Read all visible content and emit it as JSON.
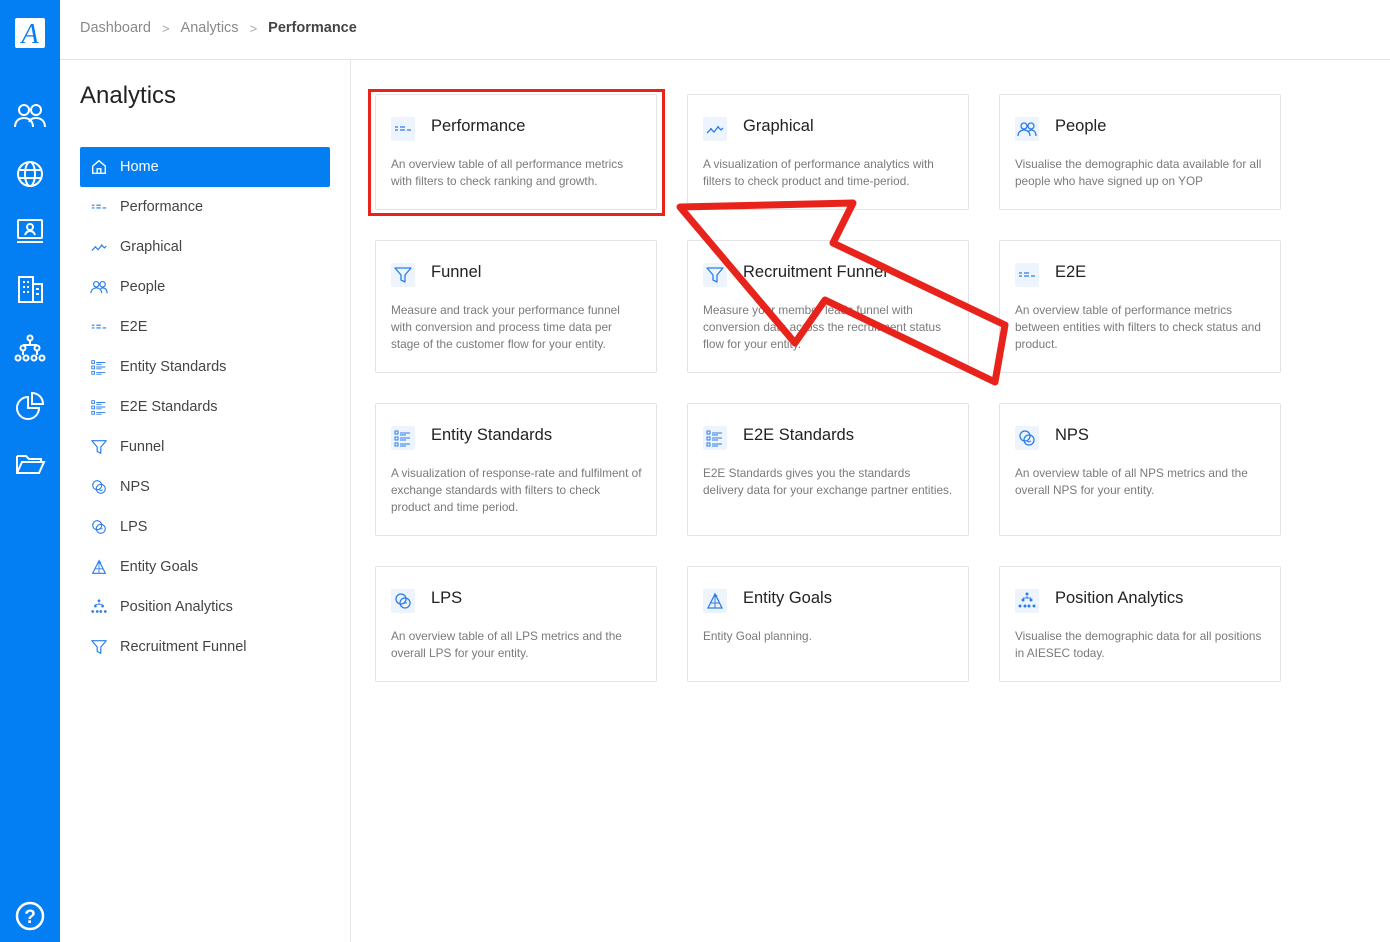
{
  "app": {
    "logo_letter": "A",
    "accent": "#037ef3",
    "highlight_color": "#e8231c"
  },
  "rail": {
    "icons": [
      "people-icon",
      "globe-icon",
      "presentation-icon",
      "building-icon",
      "org-chart-icon",
      "pie-chart-icon",
      "folder-icon",
      "help-icon"
    ],
    "help_label": "?"
  },
  "breadcrumb": {
    "items": [
      "Dashboard",
      "Analytics",
      "Performance"
    ],
    "separator": ">"
  },
  "sidenav": {
    "title": "Analytics",
    "items": [
      {
        "label": "Home",
        "icon": "home-icon",
        "active": true
      },
      {
        "label": "Performance",
        "icon": "table-lines-icon"
      },
      {
        "label": "Graphical",
        "icon": "line-graph-icon"
      },
      {
        "label": "People",
        "icon": "people-icon"
      },
      {
        "label": "E2E",
        "icon": "table-lines-icon"
      },
      {
        "label": "Entity Standards",
        "icon": "checklist-icon"
      },
      {
        "label": "E2E Standards",
        "icon": "checklist-icon"
      },
      {
        "label": "Funnel",
        "icon": "funnel-icon"
      },
      {
        "label": "NPS",
        "icon": "nps-icon"
      },
      {
        "label": "LPS",
        "icon": "lps-icon"
      },
      {
        "label": "Entity Goals",
        "icon": "goal-icon"
      },
      {
        "label": "Position Analytics",
        "icon": "org-chart-icon"
      },
      {
        "label": "Recruitment Funnel",
        "icon": "funnel-icon"
      }
    ]
  },
  "cards": [
    {
      "title": "Performance",
      "icon": "table-lines-icon",
      "desc": "An overview table of all performance metrics with filters to check ranking and growth."
    },
    {
      "title": "Graphical",
      "icon": "line-graph-icon",
      "desc": "A visualization of performance analytics with filters to check product and time-period."
    },
    {
      "title": "People",
      "icon": "people-icon",
      "desc": "Visualise the demographic data available for all people who have signed up on YOP"
    },
    {
      "title": "Funnel",
      "icon": "funnel-icon",
      "desc": "Measure and track your performance funnel with conversion and process time data per stage of the customer flow for your entity."
    },
    {
      "title": "Recruitment Funnel",
      "icon": "funnel-icon",
      "desc": "Measure your member leads funnel with conversion data across the recruitment status flow for your entity."
    },
    {
      "title": "E2E",
      "icon": "table-lines-icon",
      "desc": "An overview table of performance metrics between entities with filters to check status and product."
    },
    {
      "title": "Entity Standards",
      "icon": "checklist-icon",
      "desc": "A visualization of response-rate and fulfilment of exchange standards with filters to check product and time period."
    },
    {
      "title": "E2E Standards",
      "icon": "checklist-icon",
      "desc": "E2E Standards gives you the standards delivery data for your exchange partner entities."
    },
    {
      "title": "NPS",
      "icon": "nps-icon",
      "desc": "An overview table of all NPS metrics and the overall NPS for your entity."
    },
    {
      "title": "LPS",
      "icon": "lps-icon",
      "desc": "An overview table of all LPS metrics and the overall LPS for your entity."
    },
    {
      "title": "Entity Goals",
      "icon": "goal-icon",
      "desc": "Entity Goal planning."
    },
    {
      "title": "Position Analytics",
      "icon": "org-chart-icon",
      "desc": "Visualise the demographic data for all positions in AIESEC today."
    }
  ]
}
